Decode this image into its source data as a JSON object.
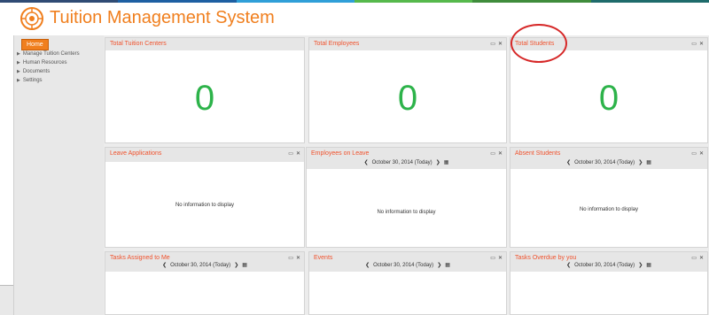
{
  "header": {
    "title": "Tuition Management System",
    "accent_color": "#f07f1e",
    "stripe_colors": [
      "#2f4b74",
      "#1d5fa2",
      "#2f9fd8",
      "#56b94c",
      "#3f8c3b",
      "#1e6b6b"
    ]
  },
  "sidebar": {
    "home_label": "Home",
    "items": [
      {
        "label": "Manage Tuition Centers"
      },
      {
        "label": "Human Resources"
      },
      {
        "label": "Documents"
      },
      {
        "label": "Settings"
      }
    ]
  },
  "panels": {
    "total_centers": {
      "title": "Total Tuition Centers",
      "value": "0"
    },
    "total_employees": {
      "title": "Total Employees",
      "value": "0"
    },
    "total_students": {
      "title": "Total Students",
      "value": "0"
    },
    "leave_applications": {
      "title": "Leave Applications",
      "empty": "No information to display"
    },
    "employees_on_leave": {
      "title": "Employees on Leave",
      "date": "October 30, 2014 (Today)",
      "empty": "No information to display"
    },
    "absent_students": {
      "title": "Absent Students",
      "date": "October 30, 2014 (Today)",
      "empty": "No information to display"
    },
    "tasks_assigned": {
      "title": "Tasks Assigned to Me",
      "date": "October 30, 2014 (Today)"
    },
    "events": {
      "title": "Events",
      "date": "October 30, 2014 (Today)"
    },
    "tasks_overdue": {
      "title": "Tasks Overdue by you",
      "date": "October 30, 2014 (Today)"
    }
  },
  "icons": {
    "prev": "chevron-left-icon",
    "next": "chevron-right-icon",
    "calendar": "calendar-icon",
    "minimize": "minimize-icon",
    "close": "close-icon"
  },
  "colors": {
    "value_green": "#2db34a",
    "panel_title": "#f0522d",
    "annotation_red": "#d62828"
  }
}
